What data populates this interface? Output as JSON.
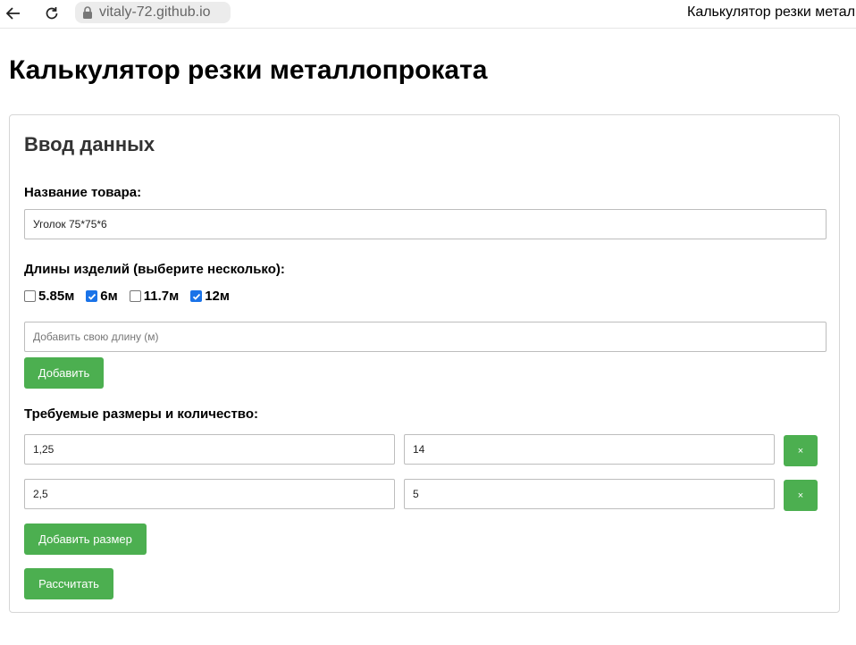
{
  "browser": {
    "url": "vitaly-72.github.io",
    "tab_title": "Калькулятор резки метал"
  },
  "page": {
    "title": "Калькулятор резки металлопроката"
  },
  "panel": {
    "heading": "Ввод данных",
    "product_label": "Название товара:",
    "product_value": "Уголок 75*75*6",
    "lengths_label": "Длины изделий (выберите несколько):",
    "lengths": [
      {
        "label": "5.85м",
        "checked": false
      },
      {
        "label": "6м",
        "checked": true
      },
      {
        "label": "11.7м",
        "checked": false
      },
      {
        "label": "12м",
        "checked": true
      }
    ],
    "custom_length_placeholder": "Добавить свою длину (м)",
    "add_button": "Добавить",
    "sizes_label": "Требуемые размеры и количество:",
    "sizes": [
      {
        "size": "1,25",
        "qty": "14",
        "remove": "×"
      },
      {
        "size": "2,5",
        "qty": "5",
        "remove": "×"
      }
    ],
    "add_size_button": "Добавить размер",
    "calculate_button": "Рассчитать"
  },
  "colors": {
    "accent": "#4caf50",
    "checkbox_checked": "#1a73e8"
  }
}
